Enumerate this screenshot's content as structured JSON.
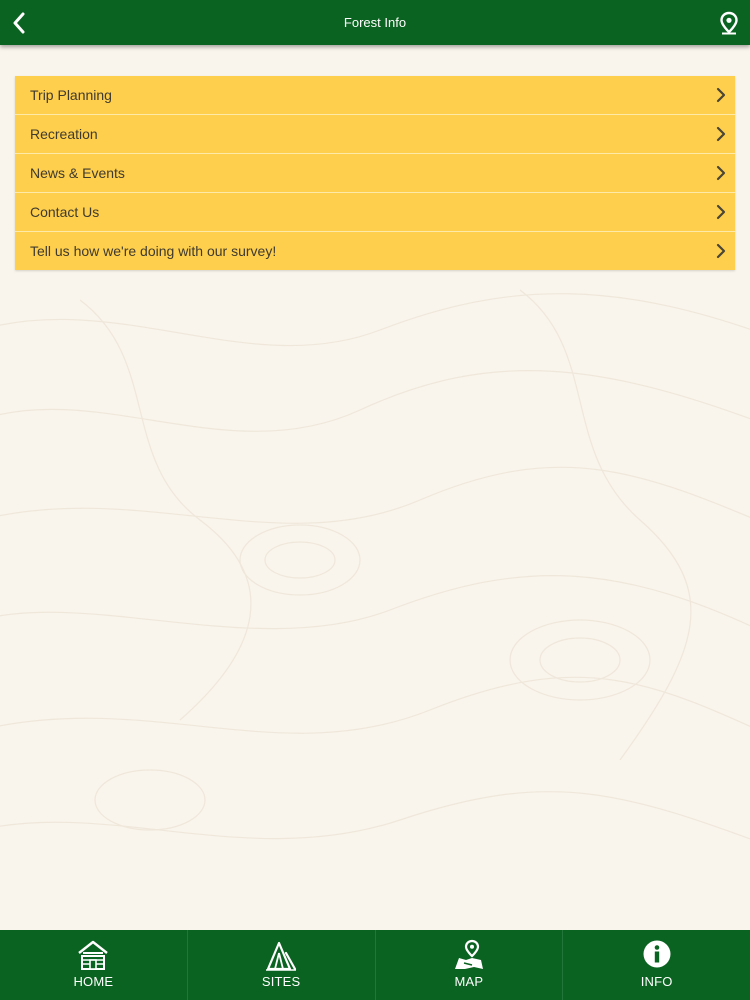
{
  "header": {
    "title": "Forest Info",
    "back_icon": "chevron-left-icon",
    "location_icon": "map-pin-icon"
  },
  "menu": {
    "items": [
      {
        "label": "Trip Planning"
      },
      {
        "label": "Recreation"
      },
      {
        "label": "News & Events"
      },
      {
        "label": "Contact Us"
      },
      {
        "label": "Tell us how we're doing with our survey!"
      }
    ]
  },
  "tabbar": {
    "tabs": [
      {
        "label": "HOME",
        "icon": "cabin-icon"
      },
      {
        "label": "SITES",
        "icon": "tent-icon"
      },
      {
        "label": "MAP",
        "icon": "map-icon"
      },
      {
        "label": "INFO",
        "icon": "info-icon"
      }
    ]
  },
  "colors": {
    "header_green": "#0b6321",
    "menu_yellow": "#fecf4c",
    "background": "#f9f4ec"
  }
}
